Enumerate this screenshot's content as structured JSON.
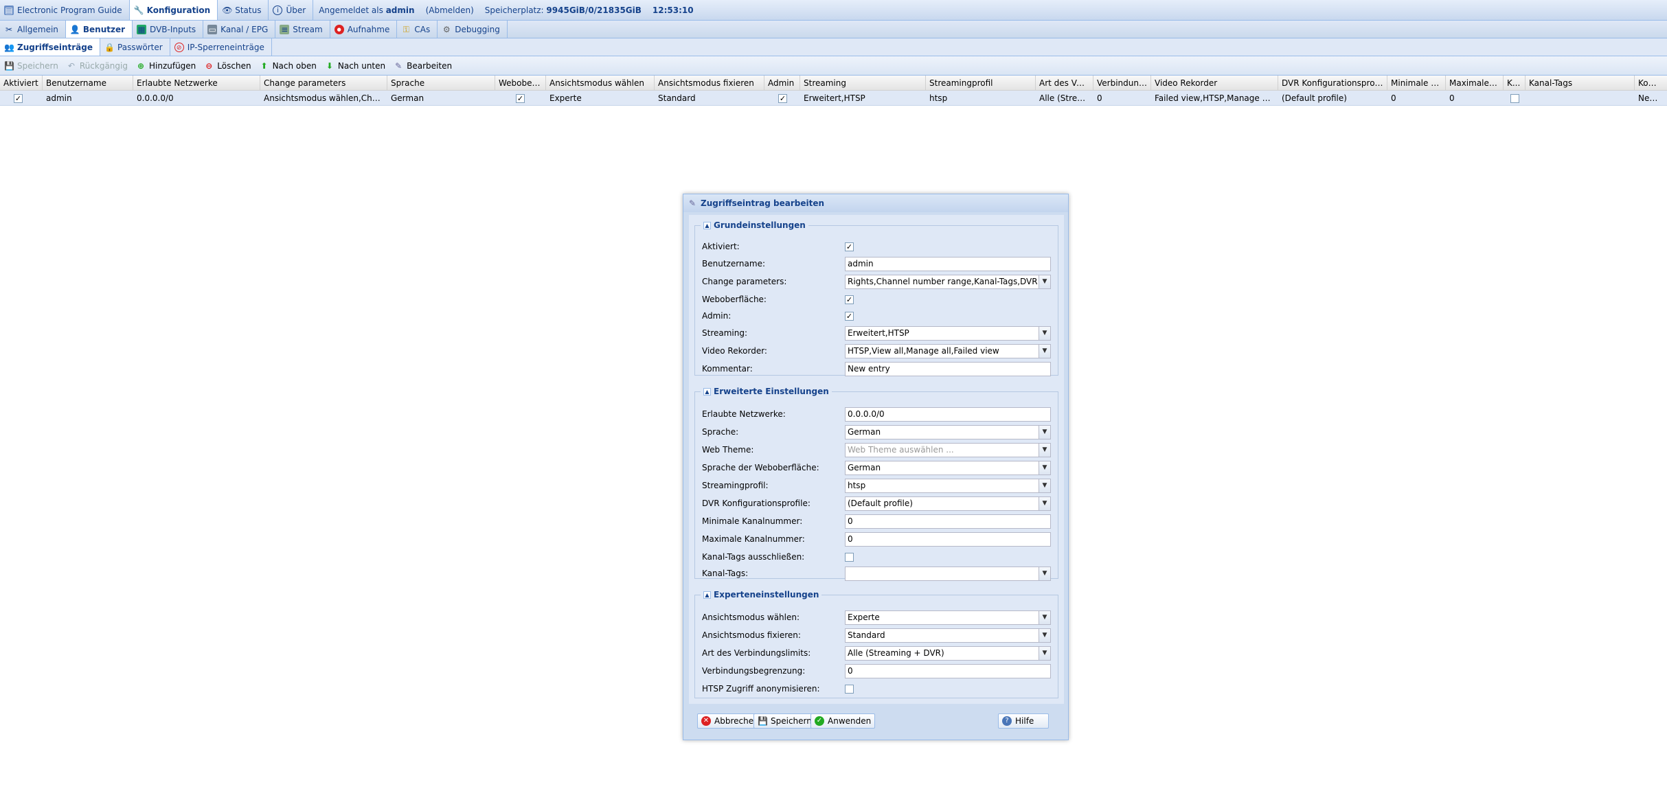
{
  "topbar": {
    "tabs": [
      {
        "label": "Electronic Program Guide",
        "icon": "epg-icon"
      },
      {
        "label": "Konfiguration",
        "icon": "wrench-icon"
      },
      {
        "label": "Status",
        "icon": "eye-icon"
      },
      {
        "label": "Über",
        "icon": "info-icon"
      }
    ],
    "logged_in_prefix": "Angemeldet als",
    "user": "admin",
    "logout": "(Abmelden)",
    "storage_label": "Speicherplatz:",
    "storage_value": "9945GiB/0/21835GiB",
    "time": "12:53:10"
  },
  "subtabs": [
    "Allgemein",
    "Benutzer",
    "DVB-Inputs",
    "Kanal / EPG",
    "Stream",
    "Aufnahme",
    "CAs",
    "Debugging"
  ],
  "subsubtabs": [
    "Zugriffseinträge",
    "Passwörter",
    "IP-Sperreneinträge"
  ],
  "toolbar": {
    "save": "Speichern",
    "undo": "Rückgängig",
    "add": "Hinzufügen",
    "delete": "Löschen",
    "up": "Nach oben",
    "down": "Nach unten",
    "edit": "Bearbeiten"
  },
  "grid": {
    "columns": [
      "Aktiviert",
      "Benutzername",
      "Erlaubte Netzwerke",
      "Change parameters",
      "Sprache",
      "Weboberfl...",
      "Ansichtsmodus wählen",
      "Ansichtsmodus fixieren",
      "Admin",
      "Streaming",
      "Streamingprofil",
      "Art des Verbi...",
      "Verbindungs...",
      "Video Rekorder",
      "DVR Konfigurationsprofile",
      "Minimale Ka...",
      "Maximale K...",
      "K...",
      "Kanal-Tags",
      "Kommentar"
    ],
    "row": {
      "aktiviert": "✓",
      "user": "admin",
      "networks": "0.0.0.0/0",
      "params": "Ansichtsmodus wählen,Channel ...",
      "sprache": "German",
      "web": "✓",
      "view": "Experte",
      "fixed": "Standard",
      "admin": "✓",
      "streaming": "Erweitert,HTSP",
      "profile": "htsp",
      "art": "Alle (Streami...",
      "limit": "0",
      "dvr": "Failed view,HTSP,Manage all,Vie...",
      "dvrprof": "(Default profile)",
      "min": "0",
      "max": "0",
      "k": "",
      "tags": "",
      "comment": "New ent"
    }
  },
  "dialog": {
    "title": "Zugriffseintrag bearbeiten",
    "basic": {
      "legend": "Grundeinstellungen",
      "aktiviert": "Aktiviert:",
      "aktiviert_v": "✓",
      "benutzername": "Benutzername:",
      "benutzername_v": "admin",
      "change": "Change parameters:",
      "change_v": "Rights,Channel number range,Kanal-Tags,DVR config",
      "web": "Weboberfläche:",
      "web_v": "✓",
      "admin": "Admin:",
      "admin_v": "✓",
      "streaming": "Streaming:",
      "streaming_v": "Erweitert,HTSP",
      "dvr": "Video Rekorder:",
      "dvr_v": "HTSP,View all,Manage all,Failed view",
      "comment": "Kommentar:",
      "comment_v": "New entry"
    },
    "advanced": {
      "legend": "Erweiterte Einstellungen",
      "networks": "Erlaubte Netzwerke:",
      "networks_v": "0.0.0.0/0",
      "lang": "Sprache:",
      "lang_v": "German",
      "theme": "Web Theme:",
      "theme_ph": "Web Theme auswählen ...",
      "uilang": "Sprache der Weboberfläche:",
      "uilang_v": "German",
      "profile": "Streamingprofil:",
      "profile_v": "htsp",
      "dvrprof": "DVR Konfigurationsprofile:",
      "dvrprof_v": "(Default profile)",
      "min": "Minimale Kanalnummer:",
      "min_v": "0",
      "max": "Maximale Kanalnummer:",
      "max_v": "0",
      "excl": "Kanal-Tags ausschließen:",
      "excl_v": "",
      "tags": "Kanal-Tags:",
      "tags_v": ""
    },
    "expert": {
      "legend": "Experteneinstellungen",
      "view": "Ansichtsmodus wählen:",
      "view_v": "Experte",
      "fixed": "Ansichtsmodus fixieren:",
      "fixed_v": "Standard",
      "art": "Art des Verbindungslimits:",
      "art_v": "Alle (Streaming + DVR)",
      "limit": "Verbindungsbegrenzung:",
      "limit_v": "0",
      "anon": "HTSP Zugriff anonymisieren:",
      "anon_v": ""
    },
    "buttons": {
      "cancel": "Abbrechen",
      "save": "Speichern",
      "apply": "Anwenden",
      "help": "Hilfe"
    }
  }
}
